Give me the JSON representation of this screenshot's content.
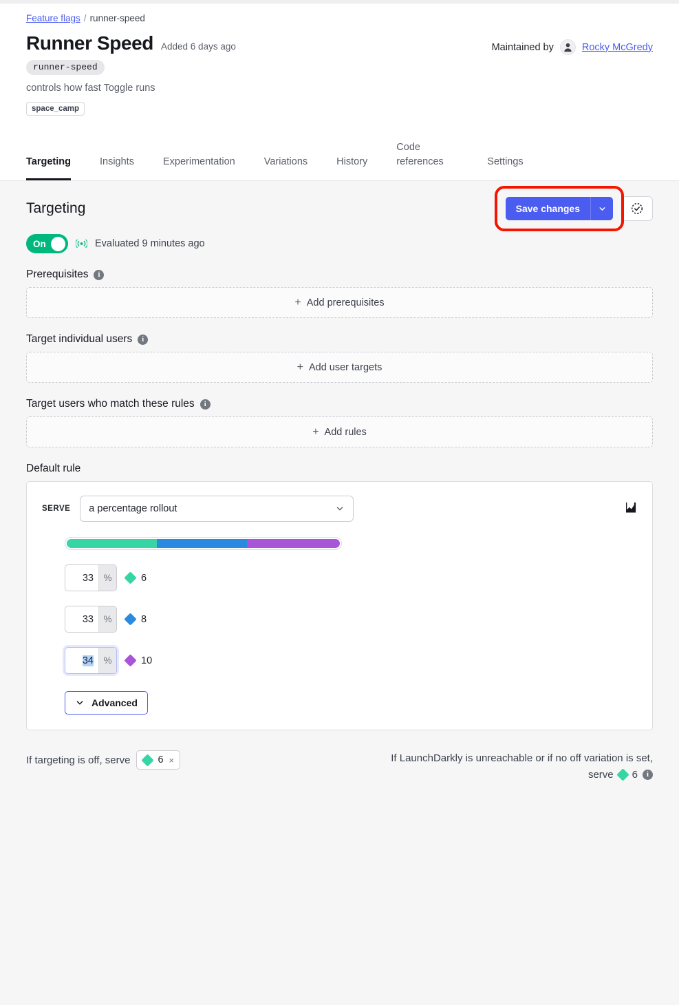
{
  "breadcrumb": {
    "root": "Feature flags",
    "separator": "/",
    "current": "runner-speed"
  },
  "header": {
    "title": "Runner Speed",
    "added": "Added 6 days ago",
    "key": "runner-speed",
    "description": "controls how fast Toggle runs",
    "tag": "space_camp",
    "maintained_label": "Maintained by",
    "maintainer": "Rocky McGredy",
    "avatar_icon": "person-icon"
  },
  "tabs": [
    {
      "label": "Targeting",
      "active": true
    },
    {
      "label": "Insights",
      "active": false
    },
    {
      "label": "Experimentation",
      "active": false
    },
    {
      "label": "Variations",
      "active": false
    },
    {
      "label": "History",
      "active": false
    },
    {
      "label": "Code\nreferences",
      "active": false
    },
    {
      "label": "Settings",
      "active": false
    }
  ],
  "main": {
    "section_title": "Targeting",
    "save_label": "Save changes",
    "save_caret_icon": "chevron-down-icon",
    "pending_changes_icon": "dashed-circle-check-icon",
    "highlight_color": "#f41500",
    "save_color": "#4b5cf0",
    "toggle": {
      "state_label": "On",
      "on": true,
      "color": "#00b87e"
    },
    "evaluated": "Evaluated 9 minutes ago",
    "evaluated_icon": "broadcast-icon",
    "sections": [
      {
        "label": "Prerequisites",
        "add_label": "Add prerequisites",
        "info_icon": "info-icon"
      },
      {
        "label": "Target individual users",
        "add_label": "Add user targets",
        "info_icon": "info-icon"
      },
      {
        "label": "Target users who match these rules",
        "add_label": "Add rules",
        "info_icon": "info-icon"
      }
    ],
    "default_rule": {
      "label": "Default rule",
      "serve_label": "SERVE",
      "serve_value": "a percentage rollout",
      "chart_icon": "analytics-chart-icon",
      "advanced_label": "Advanced",
      "advanced_icon": "chevron-down-icon",
      "rollout": [
        {
          "percent": "33",
          "suffix": "%",
          "variation": "6",
          "color": "#35d6a4",
          "focused": false
        },
        {
          "percent": "33",
          "suffix": "%",
          "variation": "8",
          "color": "#2b8ae0",
          "focused": false
        },
        {
          "percent": "34",
          "suffix": "%",
          "variation": "10",
          "color": "#a855d8",
          "focused": true
        }
      ]
    },
    "footer": {
      "off_serve_label": "If targeting is off, serve",
      "off_variation": "6",
      "off_variation_color": "#35d6a4",
      "remove_icon": "close-icon",
      "fallback_line1": "If LaunchDarkly is unreachable or if no off variation is set,",
      "fallback_serve_label": "serve",
      "fallback_variation": "6",
      "fallback_variation_color": "#35d6a4",
      "fallback_info_icon": "info-icon"
    }
  },
  "chart_data": {
    "type": "bar",
    "title": "Percentage rollout",
    "categories": [
      "6",
      "8",
      "10"
    ],
    "values": [
      33,
      33,
      34
    ],
    "colors": [
      "#35d6a4",
      "#2b8ae0",
      "#a855d8"
    ],
    "ylabel": "percent",
    "ylim": [
      0,
      100
    ]
  }
}
